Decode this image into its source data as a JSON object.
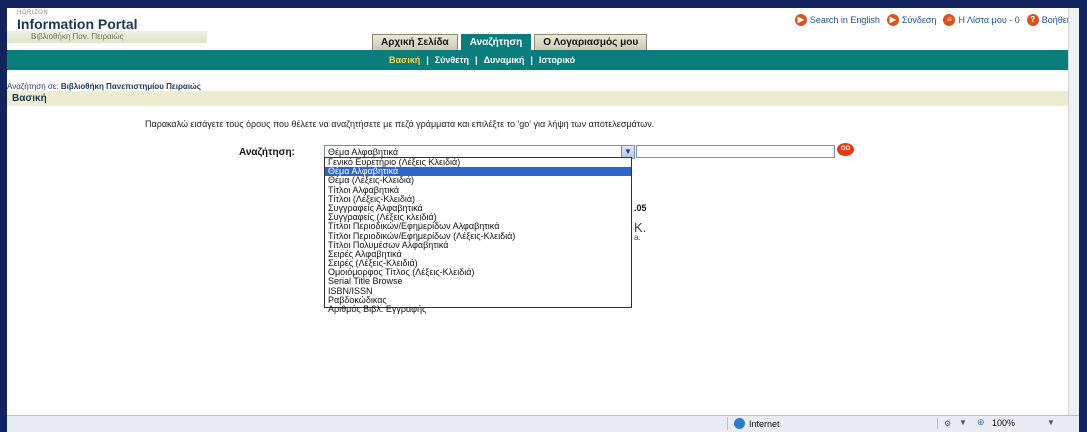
{
  "brand": {
    "tag": "HORIZON",
    "title": "Information Portal",
    "library": "Βιβλιοθήκη Παν. Πειραιώς"
  },
  "topnav": [
    {
      "label": "Search in English",
      "icon": "arrow-right-icon"
    },
    {
      "label": "Σύνδεση",
      "icon": "arrow-right-icon"
    },
    {
      "label": "Η Λίστα μου - 0",
      "icon": "list-icon"
    },
    {
      "label": "Βοήθεια",
      "icon": "help-icon"
    }
  ],
  "tabs": [
    {
      "label": "Αρχική Σελίδα",
      "active": false
    },
    {
      "label": "Αναζήτηση",
      "active": true
    },
    {
      "label": "Ο Λογαριασμός μου",
      "active": false
    }
  ],
  "subnav": [
    {
      "label": "Βασική",
      "active": true
    },
    {
      "label": "Σύνθετη",
      "active": false
    },
    {
      "label": "Δυναμική",
      "active": false
    },
    {
      "label": "Ιστορικό",
      "active": false
    }
  ],
  "scope": {
    "prefix": "Αναζήτηση σε:",
    "library": "Βιβλιοθήκη Πανεπιστημίου Πειραιώς"
  },
  "page_title": "Βασική",
  "instructions": "Παρακαλώ εισάγετε τους όρους που θέλετε να αναζητήσετε με πεζά γράμματα και επιλέξτε το 'go' για λήψη των αποτελεσμάτων.",
  "search": {
    "label": "Αναζήτηση:",
    "selected": "Θέμα Αλφαβητικά",
    "input_value": "",
    "go_label": "GO"
  },
  "dropdown_options": [
    "Γενικό Ευρετήριο (Λέξεις Κλειδιά)",
    "Θέμα Αλφαβητικά",
    "Θέμα (Λέξεις-Κλειδιά)",
    "Τίτλοι Αλφαβητικά",
    "Τίτλοι (Λέξεις-Κλειδιά)",
    "Συγγραφείς Αλφαβητικά",
    "Συγγραφείς (Λέξεις κλειδιά)",
    "Τίτλοι Περιοδικών/Εφημερίδων Αλφαβητικά",
    "Τίτλοι Περιοδικών/Εφημερίδων (Λέξεις-Κλειδιά)",
    "Τίτλοι Πολυμέσων Αλφαβητικά",
    "Σειρές Αλφαβητικά",
    "Σειρές (Λέξεις-Κλειδιά)",
    "Ομοιόμορφος Τίτλος (Λέξεις-Κλειδιά)",
    "Serial Title Browse",
    "ISBN/ISSN",
    "Ραβδοκώδικας",
    "Αριθμός Βιβλ. Εγγραφής"
  ],
  "dropdown_selected_index": 1,
  "partial_text": {
    "line1": ".05",
    "line2": "K.",
    "line3": "a."
  },
  "statusbar": {
    "zone": "Internet",
    "zoom": "100%"
  },
  "colors": {
    "teal": "#0b7d7d",
    "active_subnav": "#ffd54a",
    "page_bar": "#ececcf",
    "go_button": "#e23b17",
    "selection": "#2f65c9"
  }
}
